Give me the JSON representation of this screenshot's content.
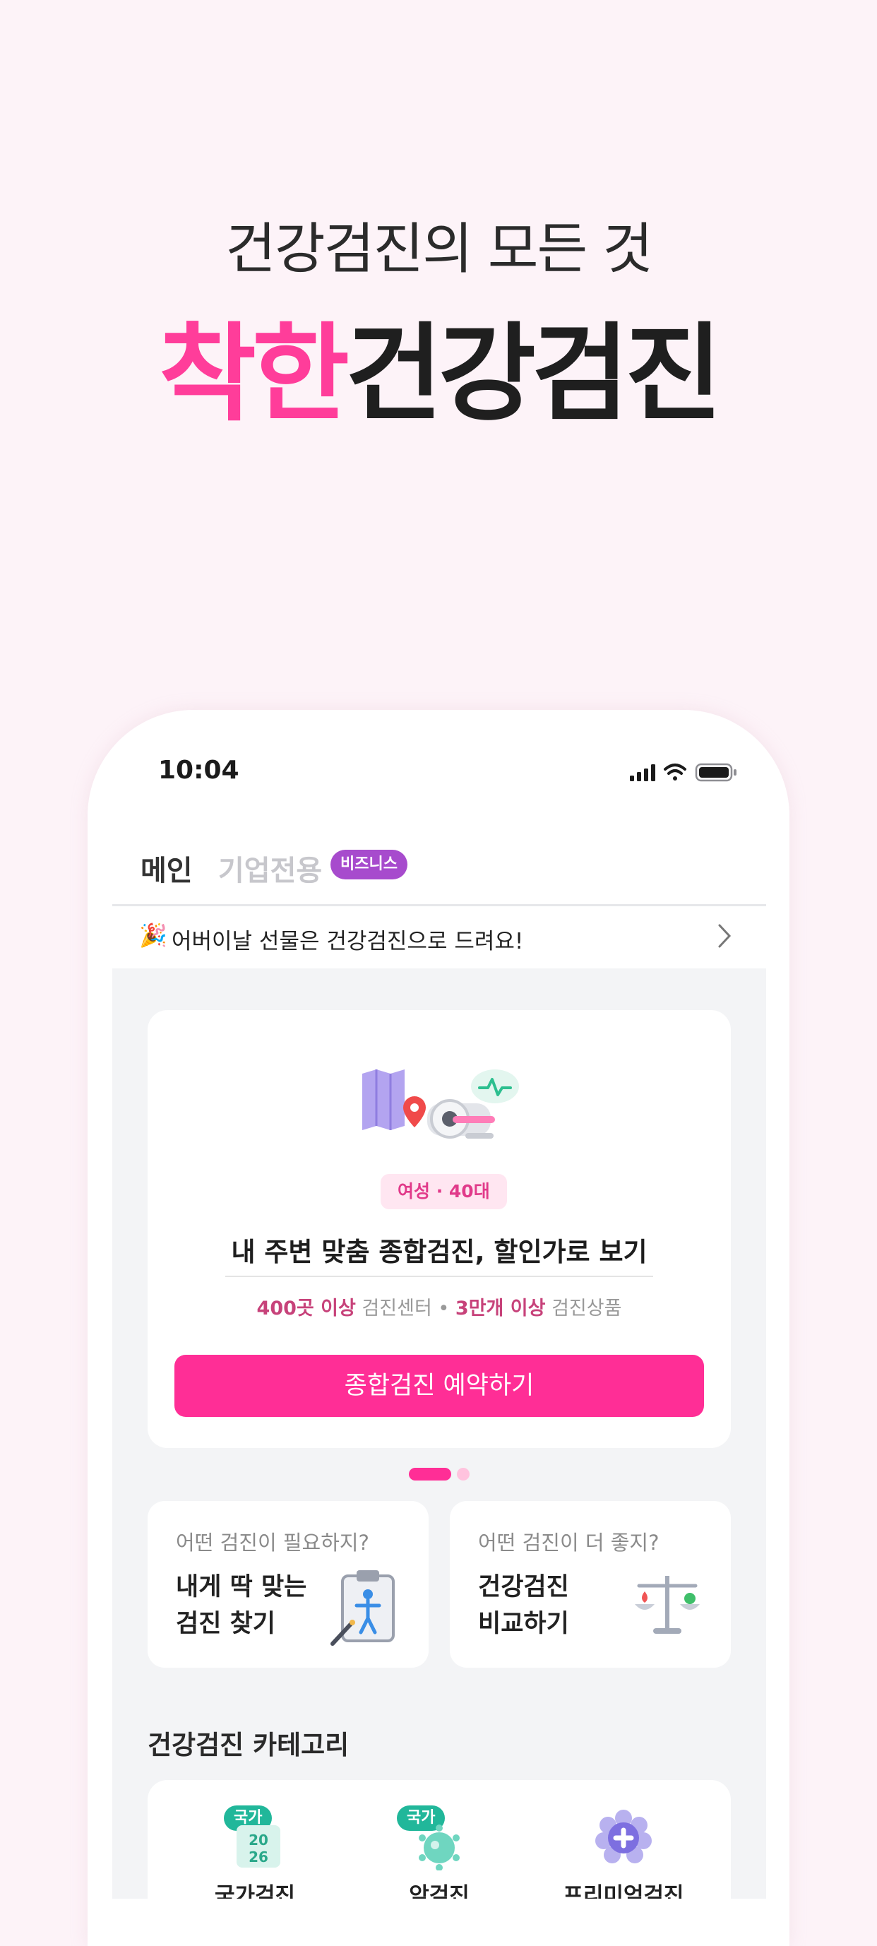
{
  "hero": {
    "subtitle": "건강검진의 모든 것",
    "title_pink": "착한",
    "title_dark": "건강검진"
  },
  "status_bar": {
    "time": "10:04",
    "icons": [
      "signal-icon",
      "wifi-icon",
      "battery-icon"
    ]
  },
  "tabs": {
    "main": "메인",
    "corporate": "기업전용",
    "business_badge": "비즈니스"
  },
  "notice": {
    "emoji": "🎉",
    "text": "어버이날 선물은 건강검진으로 드려요!"
  },
  "main_card": {
    "chip": "여성 · 40대",
    "title": "내 주변 맞춤 종합검진, 할인가로 보기",
    "stat1_highlight": "400곳 이상",
    "stat1_label": "검진센터",
    "separator": "•",
    "stat2_highlight": "3만개 이상",
    "stat2_label": "검진상품",
    "cta": "종합검진 예약하기"
  },
  "carousel": {
    "current": 1,
    "total": 2
  },
  "mini_cards": [
    {
      "question": "어떤 검진이 필요하지?",
      "title_line1": "내게 딱 맞는",
      "title_line2": "검진 찾기"
    },
    {
      "question": "어떤 검진이 더 좋지?",
      "title_line1": "건강검진",
      "title_line2": "비교하기"
    }
  ],
  "category": {
    "title": "건강검진 카테고리",
    "items": [
      {
        "label": "국가검진",
        "badge": "국가",
        "calendar_top": "20",
        "calendar_bottom": "26"
      },
      {
        "label": "암검진",
        "badge": "국가"
      },
      {
        "label": "프리미엄검진"
      }
    ]
  },
  "colors": {
    "brand_pink": "#ff2e96",
    "badge_purple": "#a74bcd",
    "badge_green": "#21b79a",
    "background": "#fdf3f8"
  }
}
